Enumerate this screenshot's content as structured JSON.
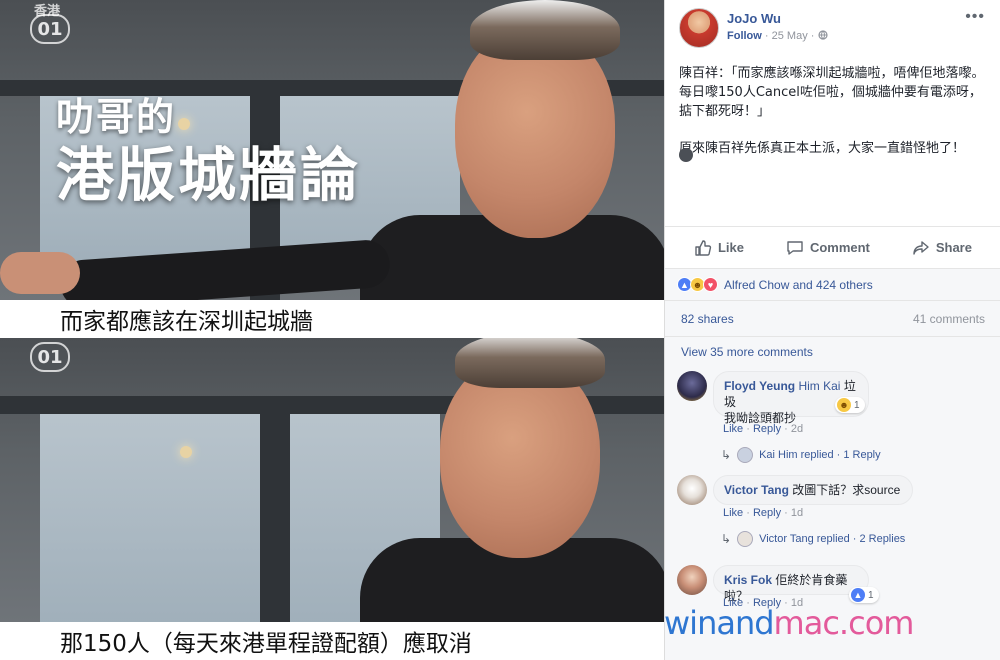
{
  "video": {
    "logo_text": "01",
    "logo_hk": "香港",
    "title_line1": "叻哥的",
    "title_line2": "港版城牆論",
    "subtitle_top": "而家都應該在深圳起城牆",
    "subtitle_bottom": "那150人（每天來港單程證配額）應取消"
  },
  "post": {
    "author": "JoJo Wu",
    "follow_label": "Follow",
    "date": "25 May",
    "privacy_icon": "globe-icon",
    "more_icon": "more-dots-icon",
    "paragraph1": "陳百祥：「而家應該喺深圳起城牆啦，唔俾佢地落嚟。每日嚟150人Cancel咗佢啦，個城牆仲要有電添呀，掂下都死呀！」",
    "paragraph2": "原來陳百祥先係真正本土派，大家一直錯怪牠了！",
    "actions": {
      "like": "Like",
      "comment": "Comment",
      "share": "Share"
    },
    "reactions_text": "Alfred Chow and 424 others",
    "shares": "82 shares",
    "comments_count": "41 comments",
    "view_more": "View 35 more comments"
  },
  "comments": [
    {
      "name": "Floyd Yeung",
      "tag": "Him Kai",
      "text_line1": "垃圾",
      "text_line2": "我呦諗頭都抄",
      "like": "Like",
      "reply": "Reply",
      "time": "2d",
      "reaction_count": "1",
      "reply_summary_name": "Kai Him replied",
      "reply_summary_count": "1 Reply"
    },
    {
      "name": "Victor Tang",
      "text": "改圖下話？求source",
      "like": "Like",
      "reply": "Reply",
      "time": "1d",
      "reply_summary_name": "Victor Tang replied",
      "reply_summary_count": "2 Replies"
    },
    {
      "name": "Kris Fok",
      "text": "佢終於肯食藥啦？",
      "like": "Like",
      "reply": "Reply",
      "time": "1d",
      "reaction_count": "1"
    }
  ],
  "watermark": {
    "part1": "winand",
    "part2": "mac.com"
  },
  "colors": {
    "facebook_blue": "#385898",
    "watermark_blue": "#2e76d1",
    "watermark_pink": "#e35a9b"
  }
}
